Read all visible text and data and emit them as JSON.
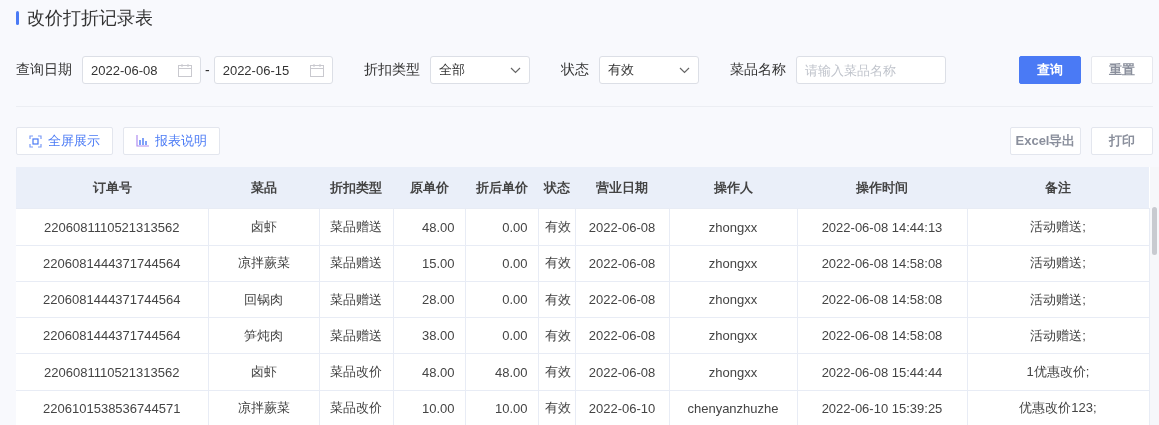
{
  "title": "改价打折记录表",
  "filters": [
    {
      "kind": "daterange",
      "label": "查询日期",
      "start": "2022-06-08",
      "separator": "-",
      "end": "2022-06-15"
    },
    {
      "kind": "select",
      "label": "折扣类型",
      "value": "全部"
    },
    {
      "kind": "select",
      "label": "状态",
      "value": "有效"
    },
    {
      "kind": "text",
      "label": "菜品名称",
      "placeholder": "请输入菜品名称"
    }
  ],
  "actions": [
    {
      "kind": "primary",
      "label": "查询"
    },
    {
      "kind": "default",
      "label": "重置"
    }
  ],
  "toolbar_left": [
    {
      "kind": "fullscreen",
      "label": "全屏展示"
    },
    {
      "kind": "chart",
      "label": "报表说明"
    }
  ],
  "toolbar_right": [
    {
      "label": "Excel导出"
    },
    {
      "label": "打印"
    }
  ],
  "table": {
    "columns": [
      {
        "label": "订单号",
        "kind": "text"
      },
      {
        "label": "菜品",
        "kind": "text"
      },
      {
        "label": "折扣类型",
        "kind": "text"
      },
      {
        "label": "原单价",
        "kind": "number"
      },
      {
        "label": "折后单价",
        "kind": "number"
      },
      {
        "label": "状态",
        "kind": "text"
      },
      {
        "label": "营业日期",
        "kind": "text"
      },
      {
        "label": "操作人",
        "kind": "text"
      },
      {
        "label": "操作时间",
        "kind": "text"
      },
      {
        "label": "备注",
        "kind": "text"
      }
    ],
    "rows": [
      [
        "2206081110521313562",
        "卤虾",
        "菜品赠送",
        "48.00",
        "0.00",
        "有效",
        "2022-06-08",
        "zhongxx",
        "2022-06-08 14:44:13",
        "活动赠送;"
      ],
      [
        "2206081444371744564",
        "凉拌蕨菜",
        "菜品赠送",
        "15.00",
        "0.00",
        "有效",
        "2022-06-08",
        "zhongxx",
        "2022-06-08 14:58:08",
        "活动赠送;"
      ],
      [
        "2206081444371744564",
        "回锅肉",
        "菜品赠送",
        "28.00",
        "0.00",
        "有效",
        "2022-06-08",
        "zhongxx",
        "2022-06-08 14:58:08",
        "活动赠送;"
      ],
      [
        "2206081444371744564",
        "笋炖肉",
        "菜品赠送",
        "38.00",
        "0.00",
        "有效",
        "2022-06-08",
        "zhongxx",
        "2022-06-08 14:58:08",
        "活动赠送;"
      ],
      [
        "2206081110521313562",
        "卤虾",
        "菜品改价",
        "48.00",
        "48.00",
        "有效",
        "2022-06-08",
        "zhongxx",
        "2022-06-08 15:44:44",
        "1优惠改价;"
      ],
      [
        "2206101538536744571",
        "凉拌蕨菜",
        "菜品改价",
        "10.00",
        "10.00",
        "有效",
        "2022-06-10",
        "chenyanzhuzhe",
        "2022-06-10 15:39:25",
        "优惠改价123;"
      ]
    ]
  }
}
